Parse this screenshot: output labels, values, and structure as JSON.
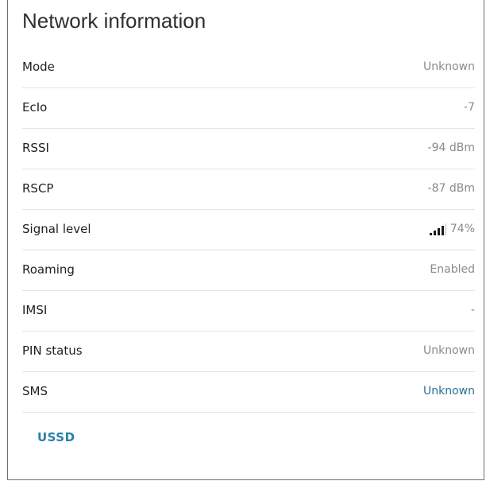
{
  "title": "Network information",
  "rows": [
    {
      "label": "Mode",
      "value": "Unknown"
    },
    {
      "label": "EcIo",
      "value": "-7"
    },
    {
      "label": "RSSI",
      "value": "-94 dBm"
    },
    {
      "label": "RSCP",
      "value": "-87 dBm"
    },
    {
      "label": "Signal level",
      "value": "74%",
      "signal_fraction": 0.74,
      "icon": "signal-bars-icon"
    },
    {
      "label": "Roaming",
      "value": "Enabled"
    },
    {
      "label": "IMSI",
      "value": "-"
    },
    {
      "label": "PIN status",
      "value": "Unknown"
    },
    {
      "label": "SMS",
      "value": "Unknown"
    }
  ],
  "ussd_label": "USSD",
  "colors": {
    "link": "#2a6f96",
    "ussd": "#2a7fa8",
    "value": "#8a8a8a",
    "label": "#1f1f1f"
  }
}
